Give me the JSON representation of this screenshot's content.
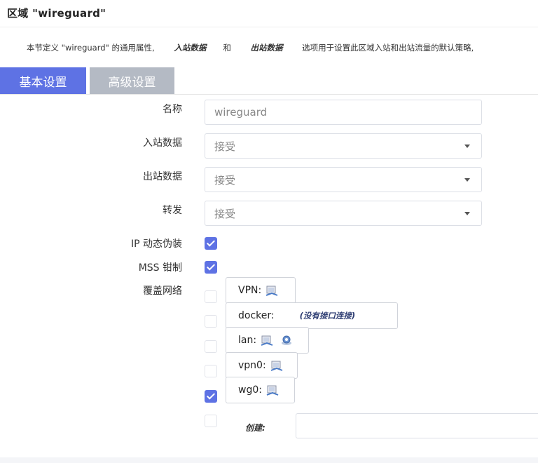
{
  "title": "区域 \"wireguard\"",
  "description": {
    "prefix": "本节定义 \"wireguard\" 的通用属性,",
    "input_link": "入站数据",
    "and": "和",
    "output_link": "出站数据",
    "suffix": "选项用于设置此区域入站和出站流量的默认策略,"
  },
  "tabs": [
    {
      "label": "基本设置",
      "active": true
    },
    {
      "label": "高级设置",
      "active": false
    }
  ],
  "form": {
    "name": {
      "label": "名称",
      "value": "wireguard"
    },
    "input": {
      "label": "入站数据",
      "value": "接受"
    },
    "output": {
      "label": "出站数据",
      "value": "接受"
    },
    "forward": {
      "label": "转发",
      "value": "接受"
    },
    "masq": {
      "label": "IP 动态伪装",
      "checked": true
    },
    "mss": {
      "label": "MSS 钳制",
      "checked": true
    },
    "covered": {
      "label": "覆盖网络"
    }
  },
  "networks": [
    {
      "name": "VPN:",
      "checked": false,
      "icons": [
        "ethernet-port-icon"
      ],
      "note": ""
    },
    {
      "name": "docker:",
      "checked": false,
      "icons": [],
      "note": "(没有接口连接)"
    },
    {
      "name": "lan:",
      "checked": false,
      "icons": [
        "ethernet-port-icon",
        "wireless-icon"
      ],
      "note": ""
    },
    {
      "name": "vpn0:",
      "checked": false,
      "icons": [
        "ethernet-port-icon"
      ],
      "note": ""
    },
    {
      "name": "wg0:",
      "checked": true,
      "icons": [
        "ethernet-port-icon"
      ],
      "note": ""
    }
  ],
  "create": {
    "label": "创建:",
    "checked": false,
    "value": ""
  },
  "colors": {
    "accent": "#5e72e4",
    "inactive_tab": "#b4bac4",
    "note": "#2f3e73"
  }
}
